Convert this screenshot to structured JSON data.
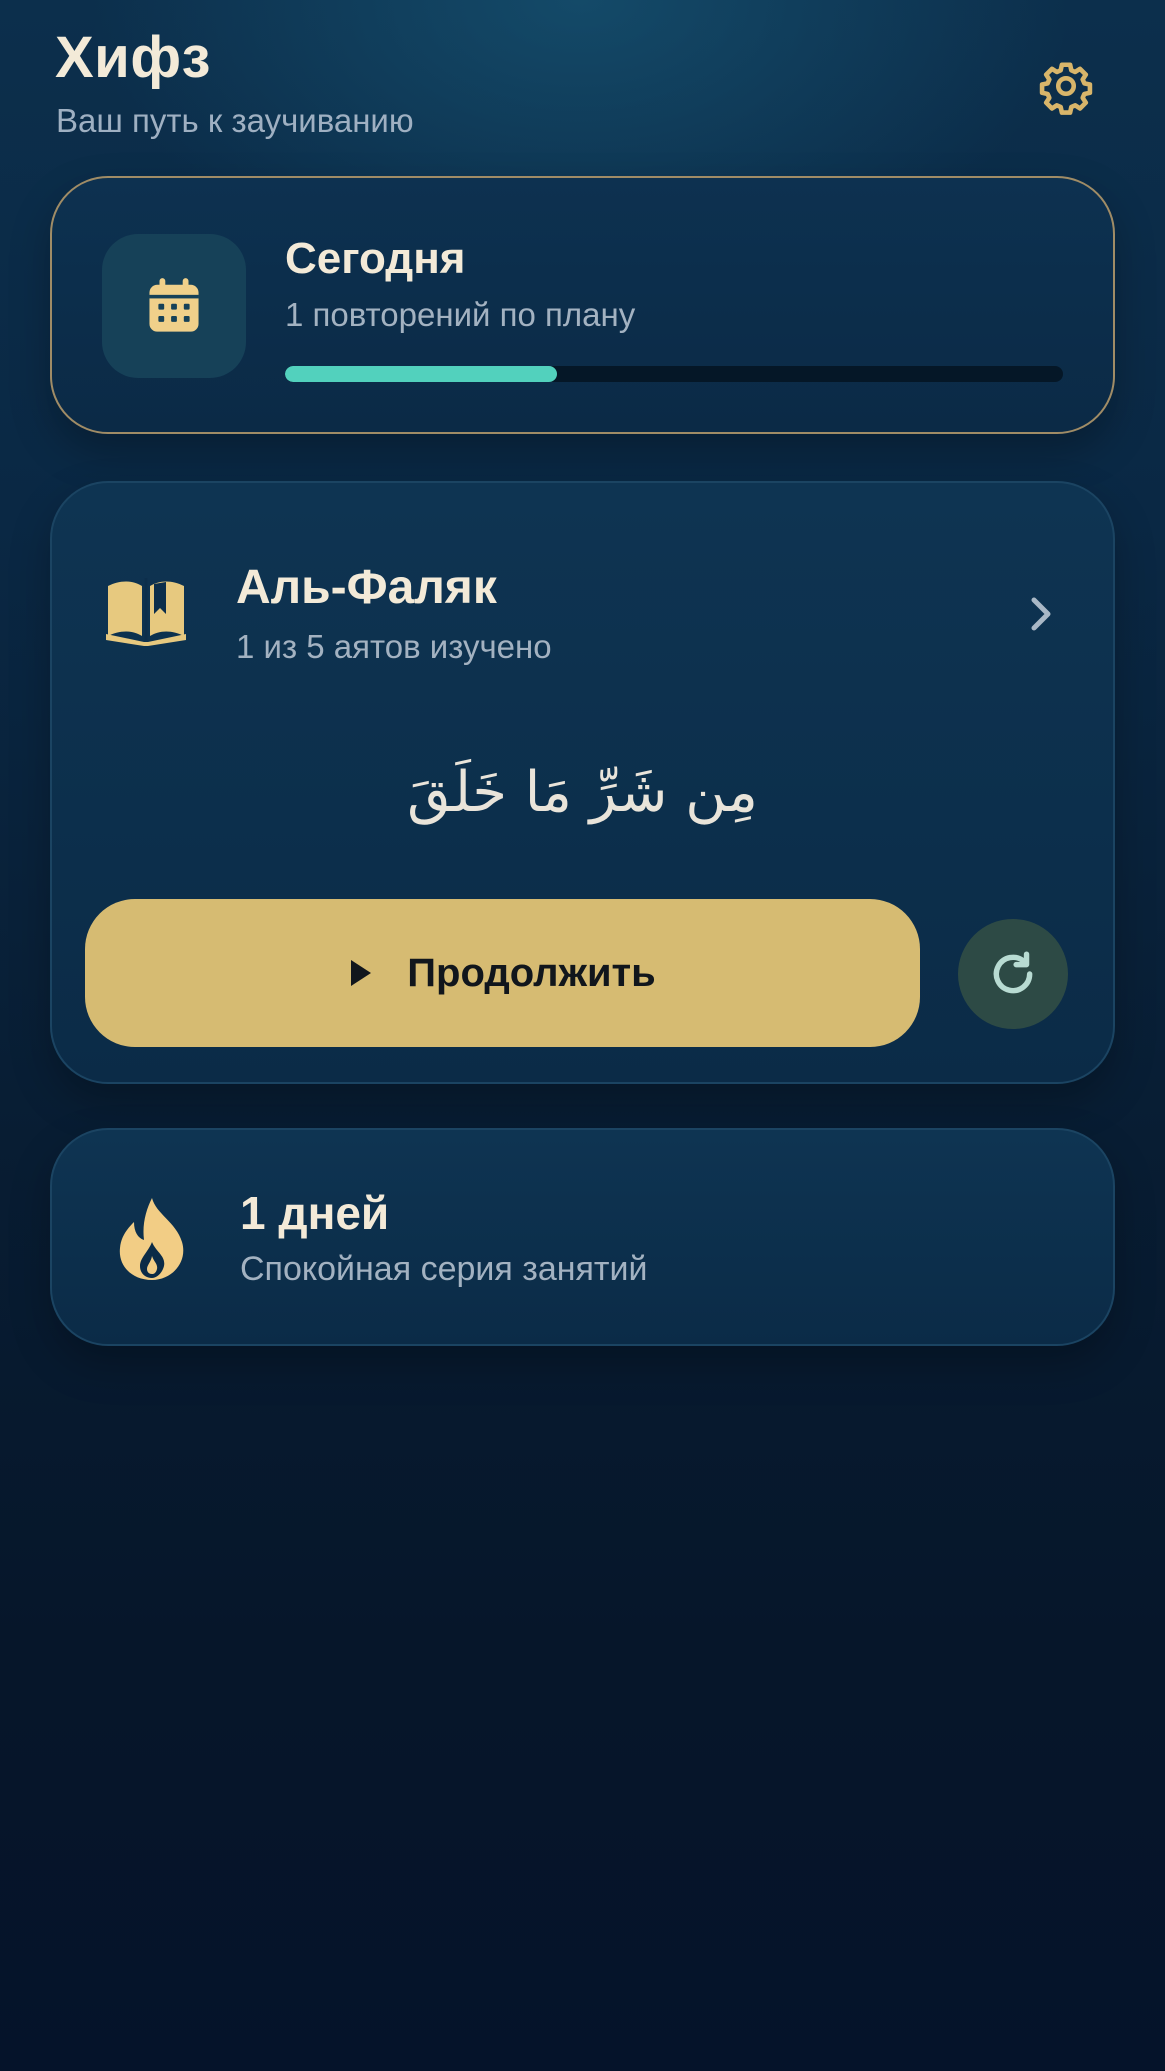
{
  "header": {
    "title": "Хифз",
    "subtitle": "Ваш путь к заучиванию"
  },
  "today": {
    "title": "Сегодня",
    "subtitle": "1 повторений по плану",
    "progress": 0.35,
    "icon": "calendar-icon"
  },
  "surah": {
    "name": "Аль-Фаляк",
    "progress_text": "1 из 5 аятов изучено",
    "ayah": "مِن شَرِّ مَا خَلَقَ",
    "continue_label": "Продолжить",
    "icons": [
      "book-open-icon",
      "chevron-right-icon",
      "play-icon",
      "refresh-icon"
    ]
  },
  "streak": {
    "title": "1 дней",
    "subtitle": "Спокойная серия занятий",
    "icon": "flame-icon"
  },
  "colors": {
    "accent_gold": "#d6bb72",
    "accent_teal": "#52d1bd",
    "text_primary": "#f3ead8",
    "text_secondary": "#a3b2c1",
    "icon_gold": "#f0d08a"
  }
}
